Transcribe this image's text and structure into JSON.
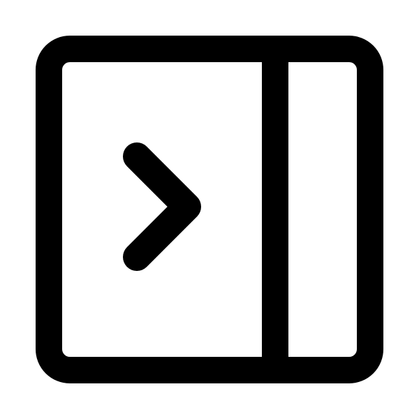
{
  "icon": {
    "name": "sidebar-right-expand-icon",
    "stroke_color": "#000000",
    "background_color": "#ffffff"
  }
}
